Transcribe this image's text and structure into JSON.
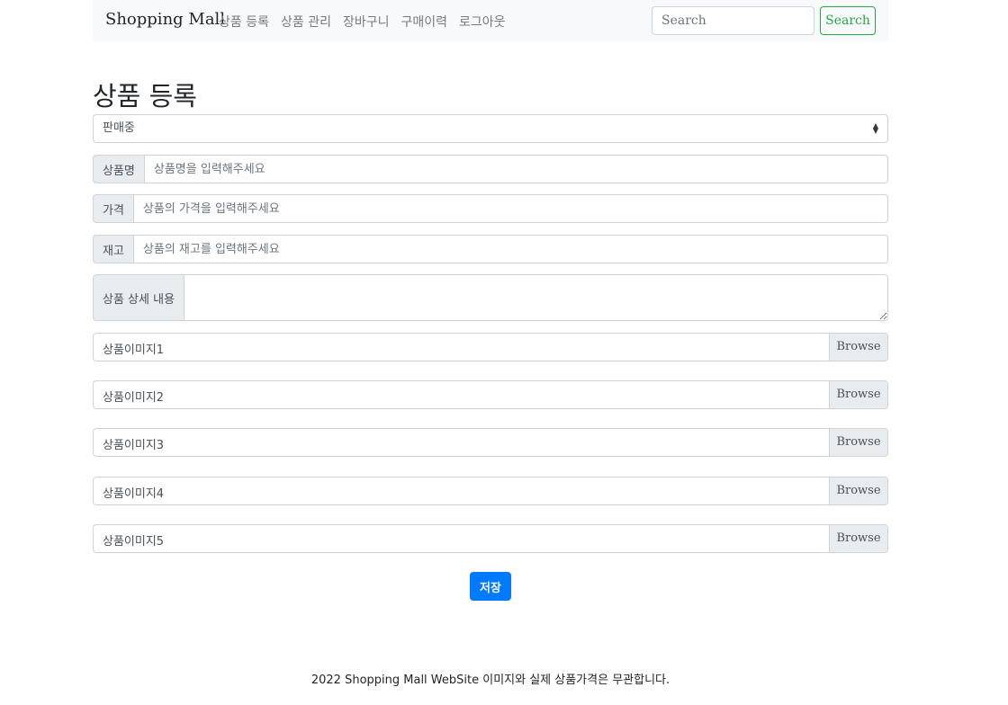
{
  "navbar": {
    "brand": "Shopping Mall",
    "links": [
      "상품 등록",
      "상품 관리",
      "장바구니",
      "구매이력",
      "로그아웃"
    ],
    "search_placeholder": "Search",
    "search_button": "Search"
  },
  "page": {
    "title": "상품 등록"
  },
  "form": {
    "status_select": {
      "selected": "판매중"
    },
    "name": {
      "label": "상품명",
      "placeholder": "상품명을 입력해주세요"
    },
    "price": {
      "label": "가격",
      "placeholder": "상품의 가격을 입력해주세요"
    },
    "stock": {
      "label": "재고",
      "placeholder": "상품의 재고를 입력해주세요"
    },
    "detail": {
      "label": "상품 상세 내용"
    },
    "images": [
      {
        "label": "상품이미지1",
        "button": "Browse"
      },
      {
        "label": "상품이미지2",
        "button": "Browse"
      },
      {
        "label": "상품이미지3",
        "button": "Browse"
      },
      {
        "label": "상품이미지4",
        "button": "Browse"
      },
      {
        "label": "상품이미지5",
        "button": "Browse"
      }
    ],
    "save_button": "저장"
  },
  "footer": {
    "text": "2022 Shopping Mall WebSite 이미지와 실제 상품가격은 무관합니다."
  },
  "colors": {
    "primary": "#007bff",
    "success": "#28a745",
    "navbar_bg": "#f8f9fa",
    "addon_bg": "#e9ecef"
  }
}
